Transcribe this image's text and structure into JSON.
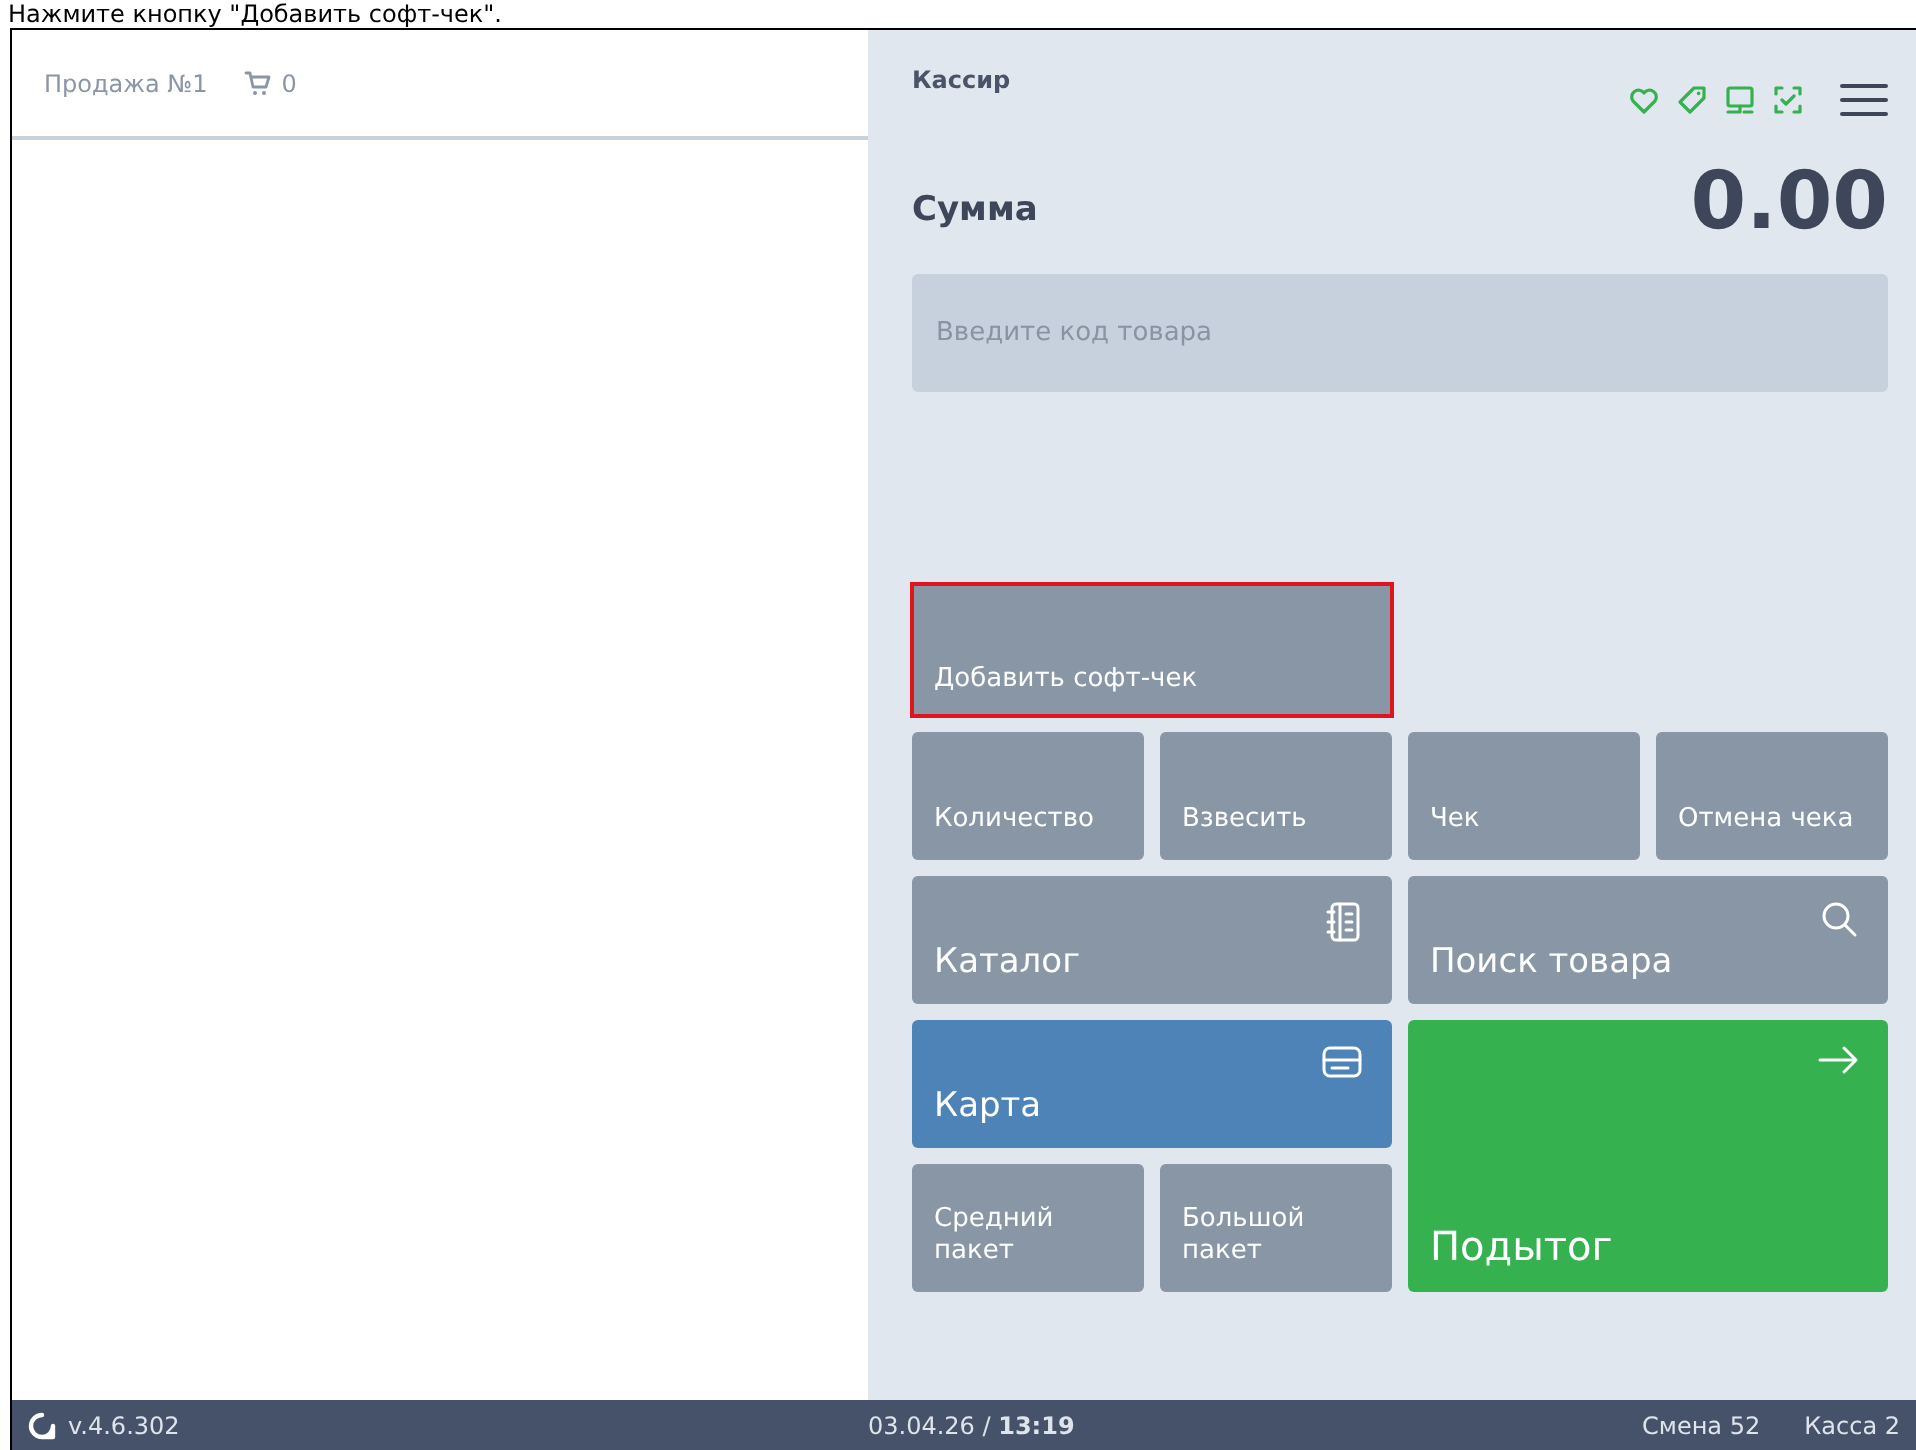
{
  "instruction": "Нажмите кнопку \"Добавить софт-чек\".",
  "sale": {
    "title": "Продажа №1",
    "cart_count": "0"
  },
  "header": {
    "role": "Кассир"
  },
  "total": {
    "label": "Сумма",
    "amount": "0.00"
  },
  "search": {
    "placeholder": "Введите код товара"
  },
  "soft_check": {
    "label": "Добавить софт-чек",
    "highlighted": true
  },
  "tiles": [
    {
      "label": "Количество",
      "kind": "plain"
    },
    {
      "label": "Взвесить",
      "kind": "plain"
    },
    {
      "label": "Чек",
      "kind": "plain"
    },
    {
      "label": "Отмена чека",
      "kind": "plain"
    },
    {
      "label": "Каталог",
      "kind": "catalog"
    },
    {
      "label": "Поиск товара",
      "kind": "search"
    },
    {
      "label": "Карта",
      "kind": "card"
    },
    {
      "label": "Средний пакет",
      "kind": "plain"
    },
    {
      "label": "Большой пакет",
      "kind": "plain"
    },
    {
      "label": "Подытог",
      "kind": "subtotal"
    }
  ],
  "status_bar": {
    "version": "v.4.6.302",
    "datetime": "03.04.26 / **13:19**",
    "shift": "Смена 52",
    "register": "Касса 2"
  }
}
